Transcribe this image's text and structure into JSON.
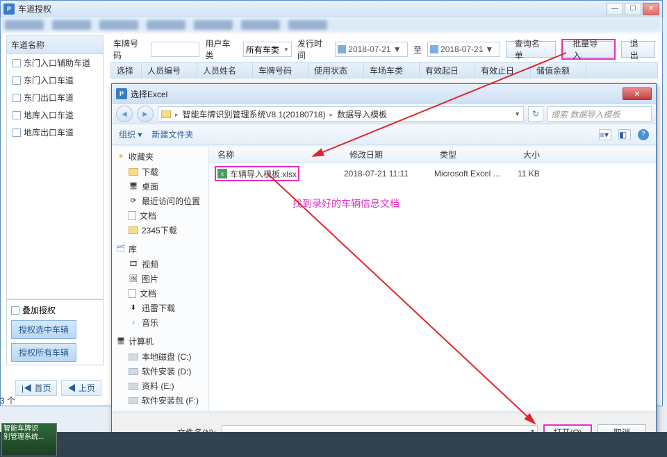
{
  "window": {
    "title": "车道授权",
    "icon_letter": "P",
    "win_min": "—",
    "win_max": "☐",
    "win_close": "✕"
  },
  "left_panel": {
    "title": "车道名称",
    "lanes": [
      "东门入口辅助车道",
      "东门入口车道",
      "东门出口车道",
      "地库入口车道",
      "地库出口车道"
    ]
  },
  "left_footer": {
    "overlay_label": "叠加授权",
    "authorize_selected": "授权选中车辆",
    "authorize_all": "授权所有车辆"
  },
  "filter_bar": {
    "plate_label": "车牌号码",
    "user_type_label": "用户车类",
    "user_type_value": "所有车类",
    "issue_label": "发行时间",
    "date_from": "2018-07-21",
    "to_label": "至",
    "date_to": "2018-07-21",
    "query_btn": "查询名单",
    "import_btn": "批量导入",
    "exit_btn": "退出"
  },
  "table_headers": [
    "选择",
    "人员编号",
    "人员姓名",
    "车牌号码",
    "使用状态",
    "车场车类",
    "有效起日",
    "有效止日",
    "储值余额"
  ],
  "dialog": {
    "title": "选择Excel",
    "icon_letter": "P",
    "breadcrumbs": [
      "智能车牌识别管理系统V8.1(20180718)",
      "数据导入模板"
    ],
    "search_placeholder": "搜索 数据导入模板",
    "organize_label": "组织",
    "new_folder_label": "新建文件夹",
    "tree": {
      "favorites": {
        "label": "收藏夹",
        "items": [
          "下载",
          "桌面",
          "最近访问的位置",
          "文档",
          "2345下载"
        ]
      },
      "libraries": {
        "label": "库",
        "items": [
          "视频",
          "图片",
          "文档",
          "迅雷下载",
          "音乐"
        ]
      },
      "computer": {
        "label": "计算机",
        "items": [
          "本地磁盘 (C:)",
          "软件安装 (D:)",
          "资料 (E:)",
          "软件安装包 (F:)"
        ]
      }
    },
    "file_header": {
      "name": "名称",
      "date": "修改日期",
      "type": "类型",
      "size": "大小"
    },
    "file": {
      "name": "车辆导入模板.xlsx",
      "date": "2018-07-21 11:11",
      "type": "Microsoft Excel ...",
      "size": "11 KB"
    },
    "annotation": "找到录好的车辆信息文档",
    "filename_label": "文件名(N):",
    "open_btn": "打开(O)",
    "cancel_btn": "取消"
  },
  "pager": {
    "first": "首页",
    "prev": "上页"
  },
  "count_label": "3 个",
  "taskbar": {
    "thumb_line1": "智能车牌识",
    "thumb_line2": "别管理系统..."
  }
}
